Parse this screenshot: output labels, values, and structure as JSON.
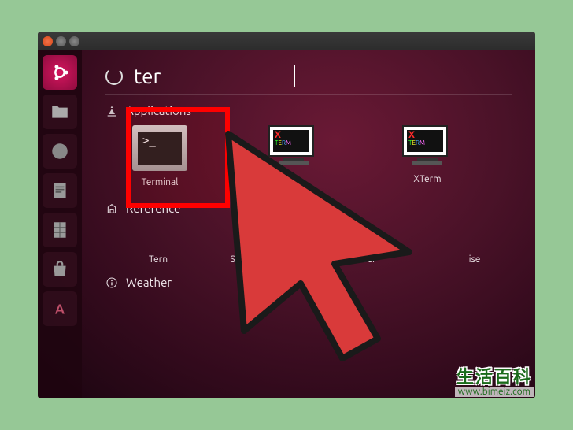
{
  "colors": {
    "page_bg": "#96c896",
    "dash_bg_inner": "#6a1935",
    "dash_bg_outer": "#1a0510",
    "highlight": "#ff0000",
    "cursor_fill": "#d93a3a",
    "cursor_stroke": "#1a1a1a"
  },
  "window": {
    "buttons": [
      "close",
      "minimize",
      "maximize"
    ]
  },
  "launcher": [
    {
      "name": "ubuntu-dash",
      "icon": "ubuntu"
    },
    {
      "name": "files",
      "icon": "folder"
    },
    {
      "name": "firefox",
      "icon": "globe"
    },
    {
      "name": "writer",
      "icon": "doc"
    },
    {
      "name": "calc",
      "icon": "sheet"
    },
    {
      "name": "software",
      "icon": "bag"
    },
    {
      "name": "amazon",
      "icon": "a_letter"
    }
  ],
  "search": {
    "value": "ter",
    "spinner": true
  },
  "sections": {
    "applications": {
      "label": "Applications",
      "items": [
        {
          "id": "terminal",
          "label": "Terminal",
          "highlighted": true
        },
        {
          "id": "uxterm",
          "label": ""
        },
        {
          "id": "xterm",
          "label": "XTerm"
        }
      ]
    },
    "reference": {
      "label": "Reference",
      "items": [
        {
          "label": "Tern"
        },
        {
          "label": "September 11 a"
        },
        {
          "label": "Ter"
        },
        {
          "label": "ise"
        }
      ]
    },
    "weather": {
      "label": "Weather"
    }
  },
  "watermark": {
    "line1": "生活百科",
    "line2": "www.bimeiz.com"
  }
}
